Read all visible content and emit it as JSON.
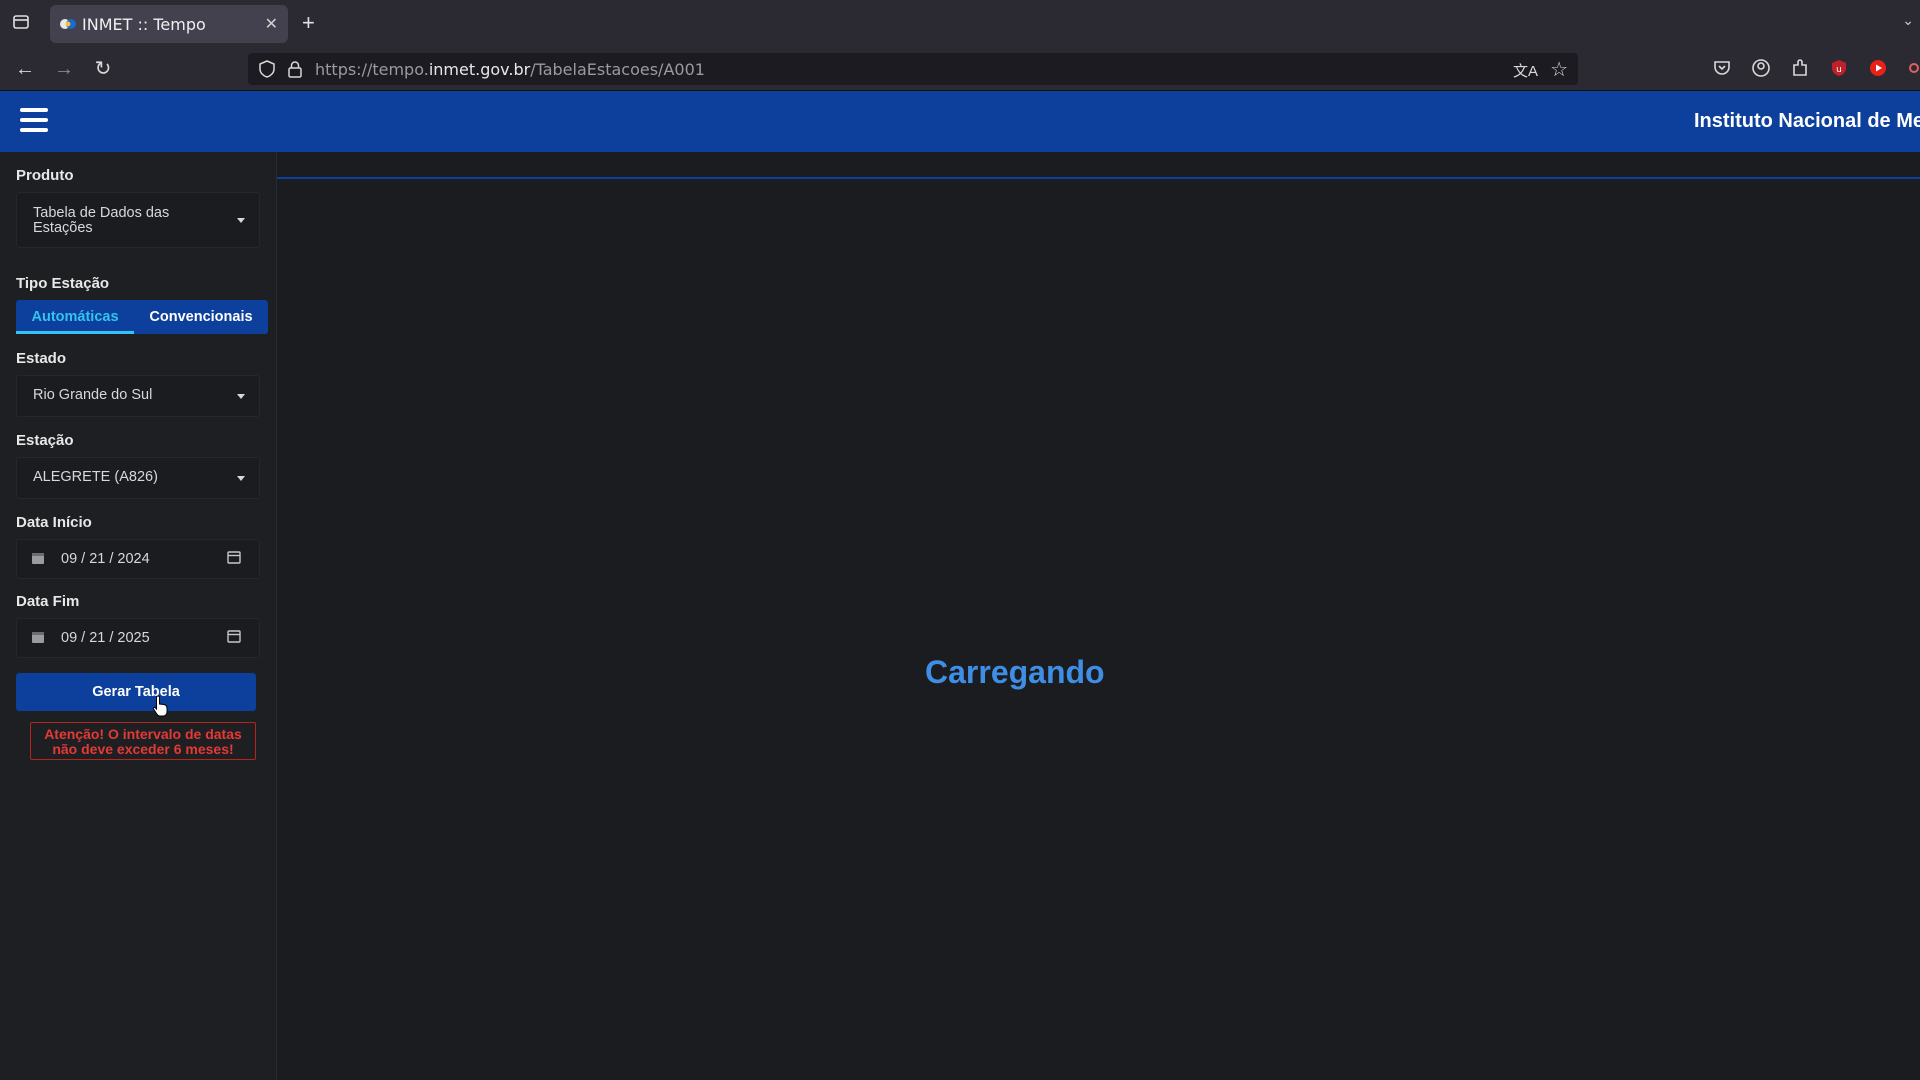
{
  "browser": {
    "tab_title": "INMET :: Tempo",
    "url_prefix": "https://tempo.",
    "url_host": "inmet.gov.br",
    "url_path": "/TabelaEstacoes/A001"
  },
  "header": {
    "title": "Instituto Nacional de Met"
  },
  "sidebar": {
    "produto_label": "Produto",
    "produto_value": "Tabela de Dados das Estações",
    "tipo_label": "Tipo Estação",
    "tipo_options": [
      "Automáticas",
      "Convencionais"
    ],
    "estado_label": "Estado",
    "estado_value": "Rio Grande do Sul",
    "estacao_label": "Estação",
    "estacao_value": "ALEGRETE (A826)",
    "data_inicio_label": "Data Início",
    "data_inicio_value": "09 / 21 / 2024",
    "data_fim_label": "Data Fim",
    "data_fim_value": "09 / 21 / 2025",
    "button_label": "Gerar Tabela",
    "warning_line1": "Atenção! O intervalo de datas",
    "warning_line2": "não deve exceder 6 meses!"
  },
  "main": {
    "loading_text": "Carregando"
  },
  "colors": {
    "brand_blue": "#0d3f9c",
    "accent_cyan": "#35c2f0",
    "warning_red": "#e53935",
    "loading_blue": "#3f8ee6"
  }
}
